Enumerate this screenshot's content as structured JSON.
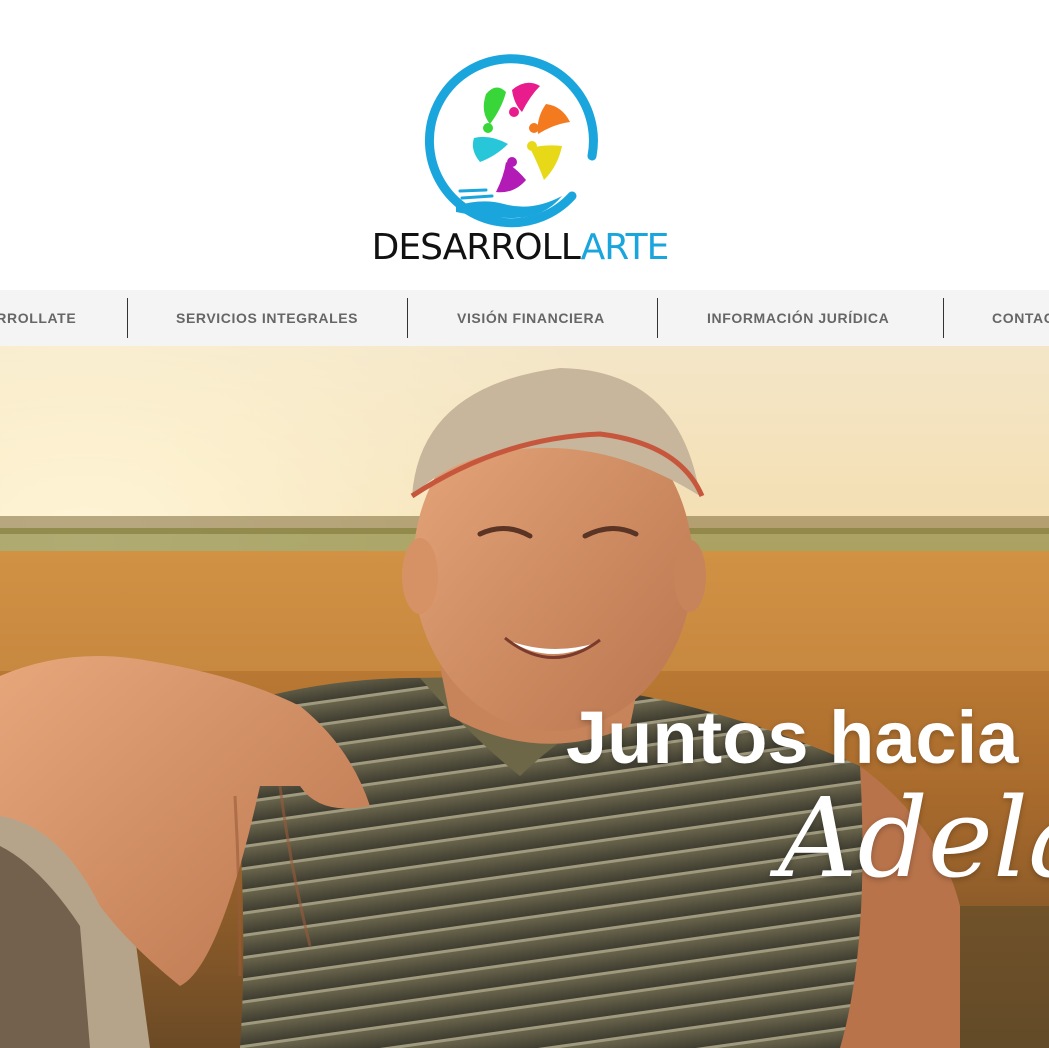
{
  "brand": {
    "wordmark_dark": "DESARROLL",
    "wordmark_accent": "ARTE",
    "accent_color": "#1aa6dd",
    "emblem_icon": "people-circle-hand-logo-icon"
  },
  "nav": {
    "items": [
      {
        "label": "DESARROLLATE"
      },
      {
        "label": "SERVICIOS INTEGRALES"
      },
      {
        "label": "VISIÓN FINANCIERA"
      },
      {
        "label": "INFORMACIÓN JURÍDICA"
      },
      {
        "label": "CONTACTO"
      }
    ]
  },
  "hero": {
    "headline": "Juntos hacia",
    "headline_script": "Adelante",
    "image": "smiling-farmer-at-sunset-field-photo"
  }
}
